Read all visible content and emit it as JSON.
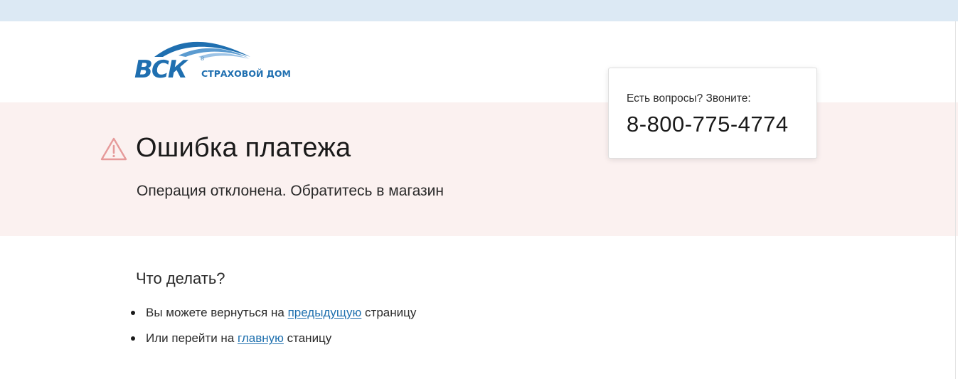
{
  "logo": {
    "brand": "ВСК",
    "registered_mark": "®",
    "subtitle": "СТРАХОВОЙ ДОМ"
  },
  "icons": {
    "warning": "warning-triangle-icon"
  },
  "colors": {
    "top_strip": "#dce9f4",
    "error_band": "#fbf1f0",
    "brand_blue": "#1f6fb0",
    "link": "#1d6fae",
    "warning": "#e69a9a"
  },
  "contact": {
    "label": "Есть вопросы? Звоните:",
    "phone": "8-800-775-4774"
  },
  "error": {
    "title": "Ошибка платежа",
    "message": "Операция отклонена. Обратитесь в магазин"
  },
  "help": {
    "heading": "Что делать?",
    "steps": [
      {
        "before": "Вы можете вернуться на",
        "link": "предыдущую",
        "after": "страницу"
      },
      {
        "before": "Или перейти на",
        "link": "главную",
        "after": "станицу"
      }
    ]
  }
}
